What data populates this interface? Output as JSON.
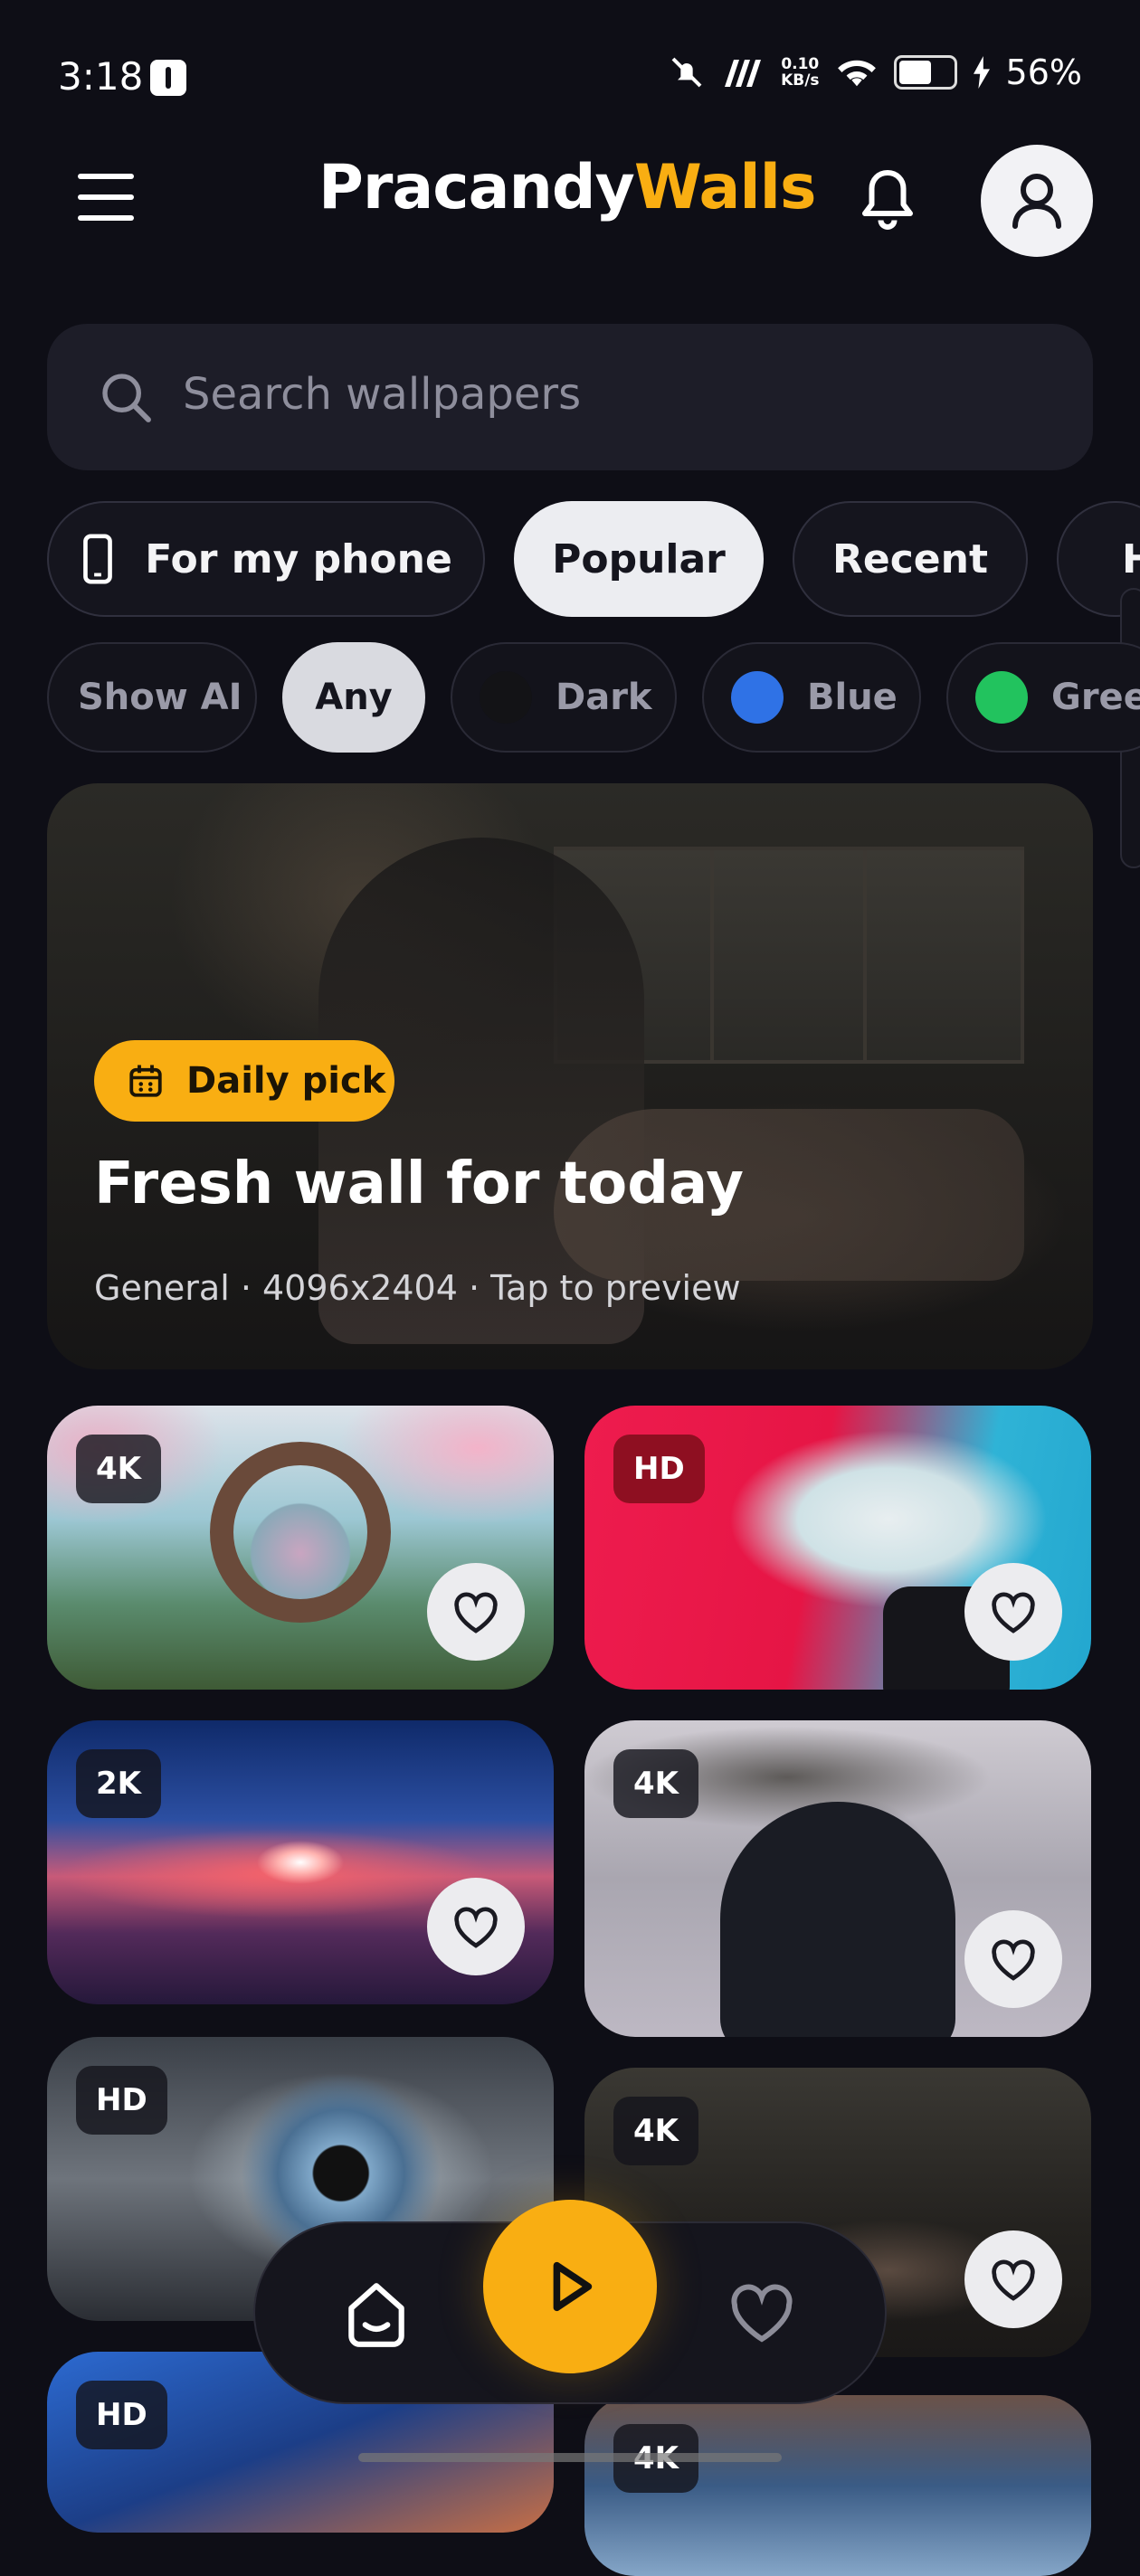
{
  "status_bar": {
    "time": "3:18",
    "net_speed_value": "0.10",
    "net_speed_unit": "KB/s",
    "battery": "56%"
  },
  "header": {
    "brand_part1": "Pracandy",
    "brand_part2": "Walls",
    "brand_accent_color": "#f9ae12"
  },
  "search": {
    "placeholder": "Search wallpapers"
  },
  "filter_tabs": [
    {
      "label": "For my phone",
      "icon": "phone-icon"
    },
    {
      "label": "Popular",
      "active": true
    },
    {
      "label": "Recent"
    },
    {
      "label": "H"
    }
  ],
  "color_filters": [
    {
      "label": "Show AI"
    },
    {
      "label": "Any",
      "active": true
    },
    {
      "label": "Dark",
      "color": "#131316"
    },
    {
      "label": "Blue",
      "color": "#2f72e6"
    },
    {
      "label": "Green",
      "color": "#22c35e"
    }
  ],
  "featured": {
    "badge": "Daily pick",
    "title": "Fresh wall for today",
    "subtitle": "General · 4096x2404 · Tap to preview"
  },
  "wallpapers": [
    {
      "quality": "4K"
    },
    {
      "quality": "HD"
    },
    {
      "quality": "2K"
    },
    {
      "quality": "4K"
    },
    {
      "quality": "HD"
    },
    {
      "quality": "4K"
    },
    {
      "quality": "HD"
    },
    {
      "quality": "4K"
    }
  ],
  "colors": {
    "background": "#0e0e16",
    "accent": "#f9ae12"
  }
}
